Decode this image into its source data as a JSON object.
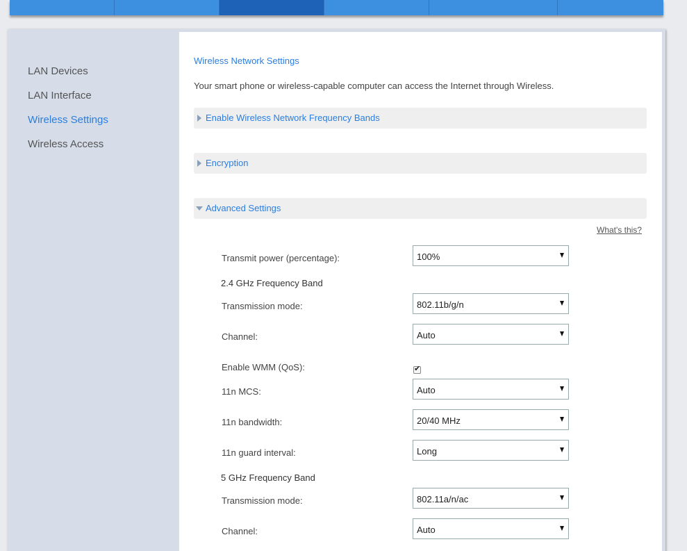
{
  "sidebar": {
    "items": [
      {
        "label": "LAN Devices"
      },
      {
        "label": "LAN Interface"
      },
      {
        "label": "Wireless Settings"
      },
      {
        "label": "Wireless Access"
      }
    ]
  },
  "main": {
    "title": "Wireless Network Settings",
    "description": "Your smart phone or wireless-capable computer can access the Internet through Wireless.",
    "sections": [
      {
        "label": "Enable Wireless Network Frequency Bands"
      },
      {
        "label": "Encryption"
      },
      {
        "label": "Advanced Settings"
      }
    ],
    "whats_this": "What's this?",
    "transmit_power": {
      "label": "Transmit power (percentage):",
      "value": "100%"
    },
    "band24": {
      "title": "2.4 GHz Frequency Band",
      "transmission_mode": {
        "label": "Transmission mode:",
        "value": "802.11b/g/n"
      },
      "channel": {
        "label": "Channel:",
        "value": "Auto"
      },
      "wmm": {
        "label": "Enable WMM (QoS):",
        "checked": true,
        "tick": "✔"
      },
      "mcs": {
        "label": "11n MCS:",
        "value": "Auto"
      },
      "bandwidth": {
        "label": "11n bandwidth:",
        "value": "20/40 MHz"
      },
      "guard": {
        "label": "11n guard interval:",
        "value": "Long"
      }
    },
    "band5": {
      "title": "5 GHz Frequency Band",
      "transmission_mode": {
        "label": "Transmission mode:",
        "value": "802.11a/n/ac"
      },
      "channel": {
        "label": "Channel:",
        "value": "Auto"
      }
    }
  },
  "colors": {
    "accent": "#2a7ee0",
    "nav": "#3d8fe0",
    "nav_active": "#1e62b8",
    "sidebar_bg": "#d6dde8"
  }
}
